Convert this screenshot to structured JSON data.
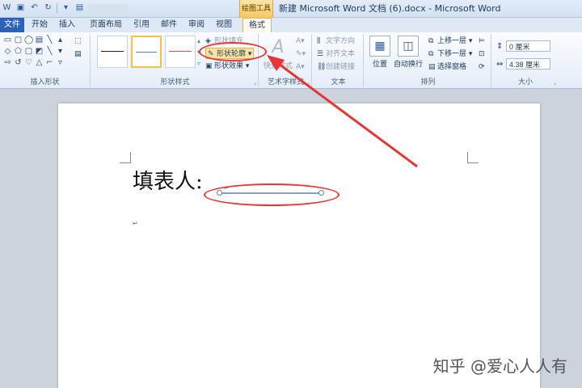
{
  "titlebar": {
    "context_group": "绘图工具",
    "document_title": "新建 Microsoft Word 文档 (6).docx - Microsoft Word"
  },
  "tabs": [
    {
      "label": "文件"
    },
    {
      "label": "开始"
    },
    {
      "label": "插入"
    },
    {
      "label": "页面布局"
    },
    {
      "label": "引用"
    },
    {
      "label": "邮件"
    },
    {
      "label": "审阅"
    },
    {
      "label": "视图"
    },
    {
      "label": "格式"
    }
  ],
  "ribbon": {
    "insert_shapes": {
      "label": "插入形状"
    },
    "shape_styles": {
      "label": "形状样式",
      "fill": "形状填充",
      "outline": "形状轮廓",
      "effects": "形状效果"
    },
    "wordart": {
      "label": "艺术字样式",
      "quick_styles": "快速样式"
    },
    "text": {
      "label": "文本",
      "direction": "文字方向",
      "align": "对齐文本",
      "link": "创建链接"
    },
    "arrange": {
      "label": "排列",
      "position": "位置",
      "wrap": "自动换行",
      "bring_forward": "上移一层",
      "send_backward": "下移一层",
      "selection_pane": "选择窗格"
    },
    "size": {
      "label": "大小",
      "height": "0 厘米",
      "width": "4.38 厘米"
    }
  },
  "document": {
    "text": "填表人:",
    "para_mark": "↵"
  },
  "watermark": "知乎 @爱心人人有",
  "colors": {
    "highlight": "#e53535",
    "file_tab": "#2b62b8",
    "context_tab": "#f6c660"
  }
}
